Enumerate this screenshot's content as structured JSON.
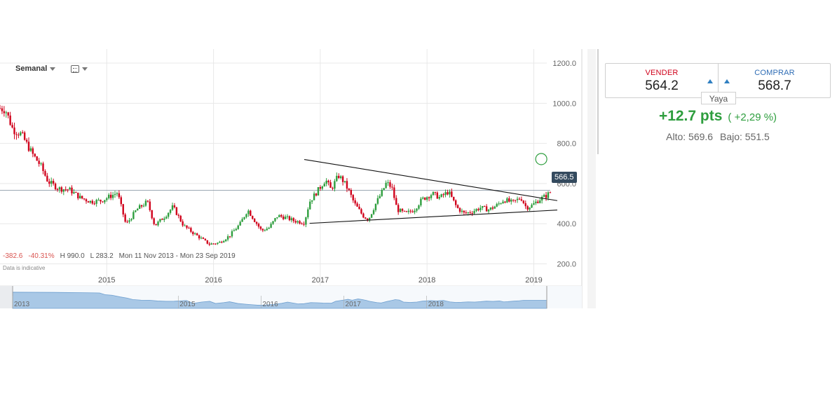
{
  "toolbar": {
    "interval": "Semanal"
  },
  "stats": {
    "change": "-382.6",
    "change_pct": "-40.31%",
    "high": "H 990.0",
    "low": "L 283.2",
    "range": "Mon 11 Nov 2013 - Mon 23 Sep 2019",
    "disclaimer": "Data is indicative"
  },
  "current_price_label": "566.5",
  "quote": {
    "sell_label": "VENDER",
    "sell_value": "564.2",
    "buy_label": "COMPRAR",
    "buy_value": "568.7",
    "spread_label": "Yaya",
    "change_pts": "+12.7 pts",
    "change_pct": "( +2,29 %)",
    "high_label": "Alto: 569.6",
    "low_label": "Bajo: 551.5"
  },
  "colors": {
    "up": "#2e9e3e",
    "down": "#d0021b",
    "accent": "#2f6db5",
    "navigator": "#a9c8e6",
    "price_tag": "#344a5e"
  },
  "chart_data": {
    "type": "candlestick",
    "x_domain": [
      2014.0,
      2019.45
    ],
    "y_domain": [
      90,
      1270
    ],
    "y_ticks": [
      200,
      400,
      600,
      800,
      1000,
      1200
    ],
    "y_tick_labels": [
      "200.0",
      "400.0",
      "600.0",
      "800.0",
      "1000.0",
      "1200.0"
    ],
    "x_ticks": [
      2015,
      2016,
      2017,
      2018,
      2019
    ],
    "x_tick_labels": [
      "2015",
      "2016",
      "2017",
      "2018",
      "2019"
    ],
    "reference_line": 566.5,
    "close_path": [
      [
        2014.0,
        975
      ],
      [
        2014.05,
        970
      ],
      [
        2014.12,
        870
      ],
      [
        2014.2,
        845
      ],
      [
        2014.3,
        750
      ],
      [
        2014.38,
        690
      ],
      [
        2014.45,
        610
      ],
      [
        2014.55,
        575
      ],
      [
        2014.65,
        570
      ],
      [
        2014.75,
        530
      ],
      [
        2014.85,
        510
      ],
      [
        2014.95,
        515
      ],
      [
        2015.1,
        555
      ],
      [
        2015.18,
        395
      ],
      [
        2015.28,
        470
      ],
      [
        2015.38,
        510
      ],
      [
        2015.45,
        390
      ],
      [
        2015.55,
        440
      ],
      [
        2015.62,
        485
      ],
      [
        2015.72,
        390
      ],
      [
        2015.82,
        350
      ],
      [
        2015.9,
        320
      ],
      [
        2015.96,
        298
      ],
      [
        2016.05,
        305
      ],
      [
        2016.15,
        340
      ],
      [
        2016.25,
        400
      ],
      [
        2016.32,
        470
      ],
      [
        2016.38,
        420
      ],
      [
        2016.45,
        365
      ],
      [
        2016.52,
        380
      ],
      [
        2016.6,
        440
      ],
      [
        2016.68,
        430
      ],
      [
        2016.75,
        415
      ],
      [
        2016.85,
        405
      ],
      [
        2016.9,
        510
      ],
      [
        2016.97,
        560
      ],
      [
        2017.05,
        620
      ],
      [
        2017.1,
        570
      ],
      [
        2017.17,
        640
      ],
      [
        2017.22,
        610
      ],
      [
        2017.27,
        560
      ],
      [
        2017.32,
        500
      ],
      [
        2017.4,
        440
      ],
      [
        2017.45,
        420
      ],
      [
        2017.52,
        500
      ],
      [
        2017.58,
        560
      ],
      [
        2017.62,
        605
      ],
      [
        2017.67,
        580
      ],
      [
        2017.72,
        470
      ],
      [
        2017.8,
        450
      ],
      [
        2017.88,
        470
      ],
      [
        2017.95,
        520
      ],
      [
        2018.05,
        550
      ],
      [
        2018.12,
        530
      ],
      [
        2018.2,
        560
      ],
      [
        2018.28,
        480
      ],
      [
        2018.35,
        450
      ],
      [
        2018.42,
        460
      ],
      [
        2018.5,
        480
      ],
      [
        2018.58,
        470
      ],
      [
        2018.65,
        490
      ],
      [
        2018.72,
        520
      ],
      [
        2018.8,
        505
      ],
      [
        2018.88,
        530
      ],
      [
        2018.93,
        480
      ],
      [
        2018.98,
        490
      ],
      [
        2019.05,
        520
      ],
      [
        2019.12,
        540
      ],
      [
        2019.17,
        566
      ]
    ],
    "trendlines": [
      {
        "from": [
          2016.85,
          720
        ],
        "to": [
          2019.22,
          515
        ]
      },
      {
        "from": [
          2016.9,
          402
        ],
        "to": [
          2019.22,
          468
        ]
      }
    ],
    "annotation_circle": {
      "x": 2019.07,
      "y": 722
    }
  }
}
